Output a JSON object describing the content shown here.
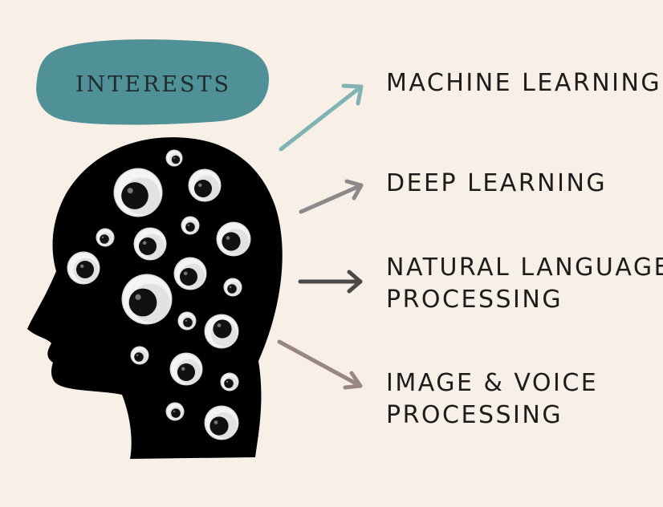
{
  "title": "INTERESTS",
  "colors": {
    "background": "#f8efe6",
    "title_blob": "#4f9196",
    "head": "#000000",
    "arrows": [
      "#7fb3b4",
      "#8a8a8a",
      "#4a4a4a",
      "#9a8782"
    ]
  },
  "interests": [
    {
      "lines": [
        "MACHINE LEARNING"
      ]
    },
    {
      "lines": [
        "DEEP LEARNING"
      ]
    },
    {
      "lines": [
        "NATURAL LANGUAGE",
        "PROCESSING"
      ]
    },
    {
      "lines": [
        "IMAGE & VOICE",
        "PROCESSING"
      ]
    }
  ]
}
